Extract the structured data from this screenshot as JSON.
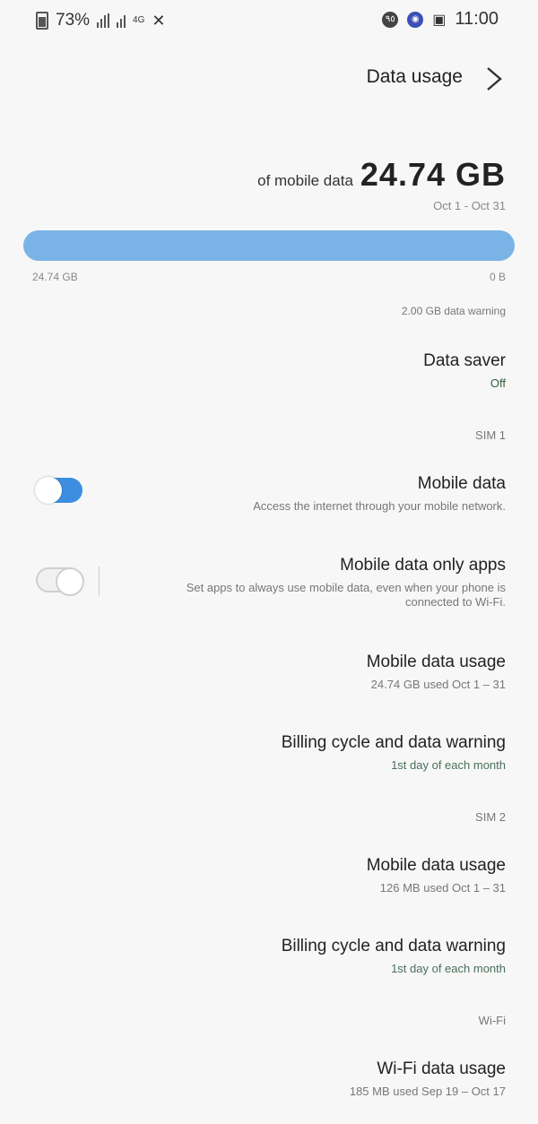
{
  "status_bar": {
    "time": "11:00",
    "battery": "73%",
    "network": "4G",
    "badge_number": "٩٥"
  },
  "header": {
    "title": "Data usage"
  },
  "summary": {
    "amount": "24.74 GB",
    "suffix": "of mobile data",
    "period": "Oct 1 - Oct 31",
    "bar_left_label": "24.74 GB",
    "bar_right_label": "0 B",
    "bar_fill_fraction": 1.0,
    "warning": "2.00 GB data warning"
  },
  "data_saver": {
    "title": "Data saver",
    "status": "Off"
  },
  "sim1": {
    "section_label": "SIM 1",
    "mobile_data": {
      "title": "Mobile data",
      "subtitle": "Access the internet through your mobile network.",
      "enabled": true
    },
    "mobile_data_only_apps": {
      "title": "Mobile data only apps",
      "subtitle_line1": "Set apps to always use mobile data, even when your phone is",
      "subtitle_line2": "connected to Wi-Fi.",
      "enabled": false
    },
    "mobile_data_usage": {
      "title": "Mobile data usage",
      "subtitle": "24.74 GB used Oct 1 – 31"
    },
    "billing": {
      "title": "Billing cycle and data warning",
      "subtitle": "1st day of each month"
    }
  },
  "sim2": {
    "section_label": "SIM 2",
    "mobile_data_usage": {
      "title": "Mobile data usage",
      "subtitle": "126 MB used Oct 1 – 31"
    },
    "billing": {
      "title": "Billing cycle and data warning",
      "subtitle": "1st day of each month"
    }
  },
  "wifi": {
    "section_label": "Wi-Fi",
    "usage": {
      "title": "Wi-Fi data usage",
      "subtitle": "185 MB used Sep 19 – Oct 17"
    }
  },
  "colors": {
    "accent": "#3d8ee0",
    "bar": "#7ab4e6",
    "background": "#f7f7f7"
  }
}
